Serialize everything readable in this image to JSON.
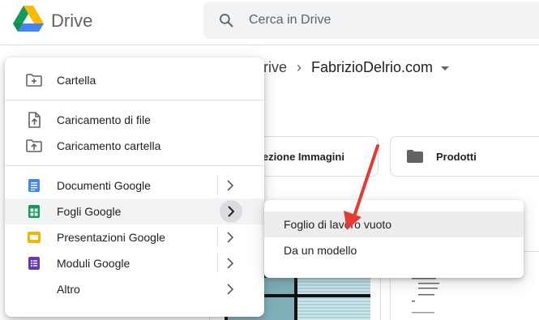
{
  "app": {
    "name": "Drive"
  },
  "search": {
    "placeholder": "Cerca in Drive"
  },
  "breadcrumb": {
    "first": "rive",
    "current": "FabrizioDelrio.com"
  },
  "folders": [
    {
      "name": "elezione Immagini"
    },
    {
      "name": "Prodotti"
    }
  ],
  "menu": {
    "new_folder": "Cartella",
    "upload_file": "Caricamento di file",
    "upload_folder": "Caricamento cartella",
    "docs": "Documenti Google",
    "sheets": "Fogli Google",
    "slides": "Presentazioni Google",
    "forms": "Moduli Google",
    "more": "Altro"
  },
  "submenu": {
    "blank": "Foglio di lavoro vuoto",
    "template": "Da un modello"
  },
  "colors": {
    "docs": "#4285f4",
    "sheets": "#0f9d58",
    "slides": "#f4b400",
    "forms": "#673ab7",
    "annotation": "#e53935"
  }
}
